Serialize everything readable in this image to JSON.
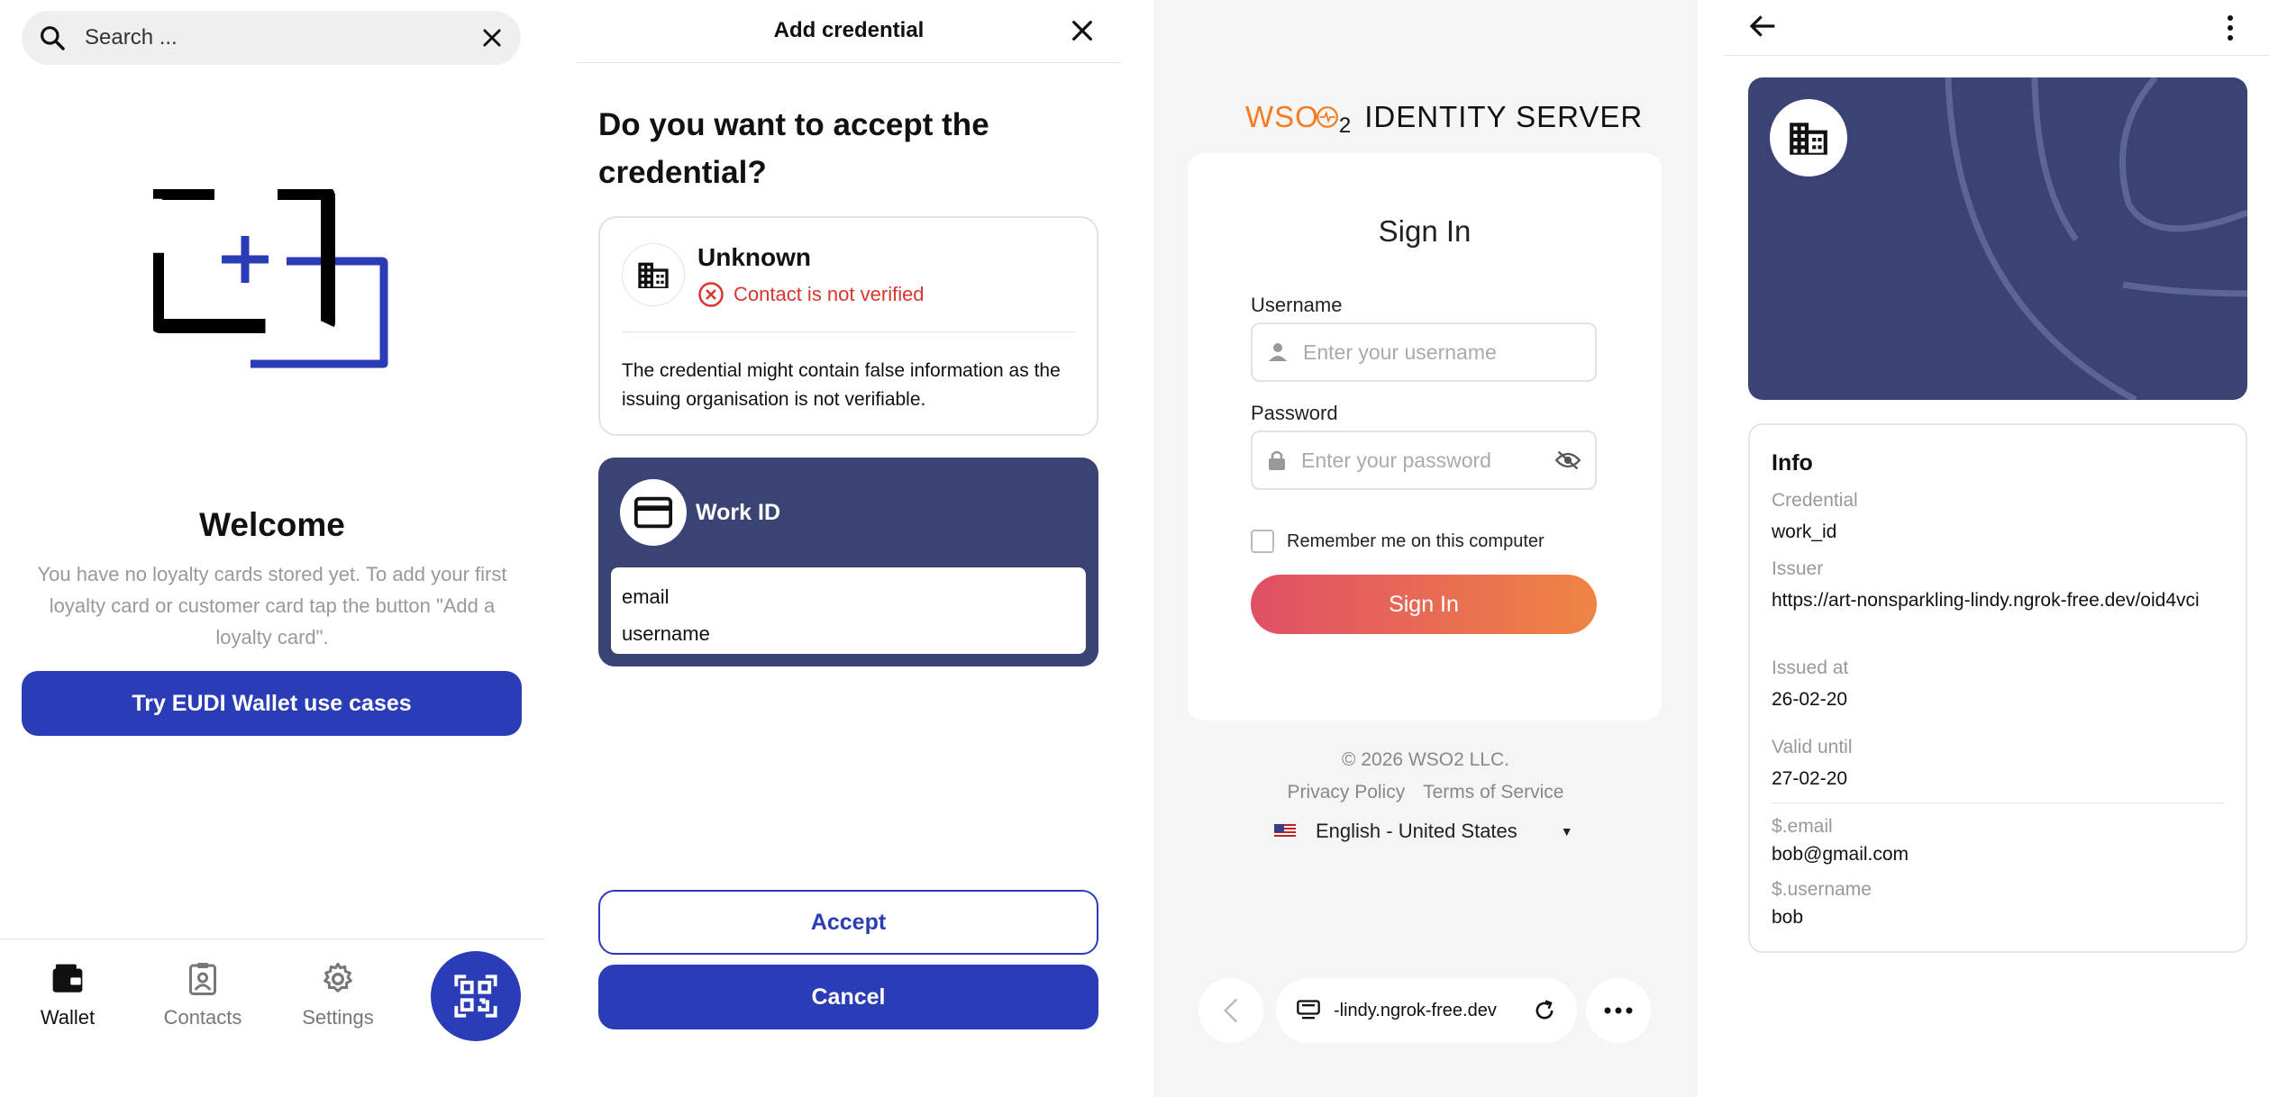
{
  "wallet": {
    "search_placeholder": "Search ...",
    "welcome_title": "Welcome",
    "welcome_desc": "You have no loyalty cards stored yet. To add your first loyalty card or customer card tap the button \"Add a loyalty card\".",
    "try_button": "Try EUDI Wallet use cases",
    "nav": [
      {
        "label": "Wallet",
        "icon": "wallet-icon",
        "active": true
      },
      {
        "label": "Contacts",
        "icon": "contacts-icon",
        "active": false
      },
      {
        "label": "Settings",
        "icon": "settings-icon",
        "active": false
      }
    ],
    "fab_icon": "qr-scan-icon"
  },
  "add_credential": {
    "title": "Add credential",
    "question": "Do you want to accept the credential?",
    "issuer": {
      "name": "Unknown",
      "status": "Contact is not verified",
      "warning": "The credential might contain false information as the issuing organisation is not verifiable."
    },
    "credential": {
      "name": "Work ID",
      "claims": [
        "email",
        "username"
      ]
    },
    "accept_label": "Accept",
    "cancel_label": "Cancel"
  },
  "signin": {
    "brand": "WSO",
    "brand_sub": "2",
    "brand_product": "IDENTITY SERVER",
    "title": "Sign In",
    "username_label": "Username",
    "username_placeholder": "Enter your username",
    "password_label": "Password",
    "password_placeholder": "Enter your password",
    "remember_label": "Remember me on this computer",
    "button": "Sign In",
    "copyright": "© 2026 WSO2 LLC.",
    "privacy": "Privacy Policy",
    "terms": "Terms of Service",
    "language": "English - United States",
    "url": "-lindy.ngrok-free.dev"
  },
  "details": {
    "info_title": "Info",
    "fields": [
      {
        "label": "Credential",
        "value": "work_id"
      },
      {
        "label": "Issuer",
        "value": "https://art-nonsparkling-lindy.ngrok-free.dev/oid4vci"
      },
      {
        "label": "Issued at",
        "value": "26-02-20"
      },
      {
        "label": "Valid until",
        "value": "27-02-20"
      },
      {
        "label": "$.email",
        "value": "bob@gmail.com"
      },
      {
        "label": "$.username",
        "value": "bob"
      }
    ]
  },
  "colors": {
    "primary": "#2a3db6",
    "card": "#3a4374",
    "error": "#d9352f",
    "wso2_orange": "#f47b20"
  }
}
